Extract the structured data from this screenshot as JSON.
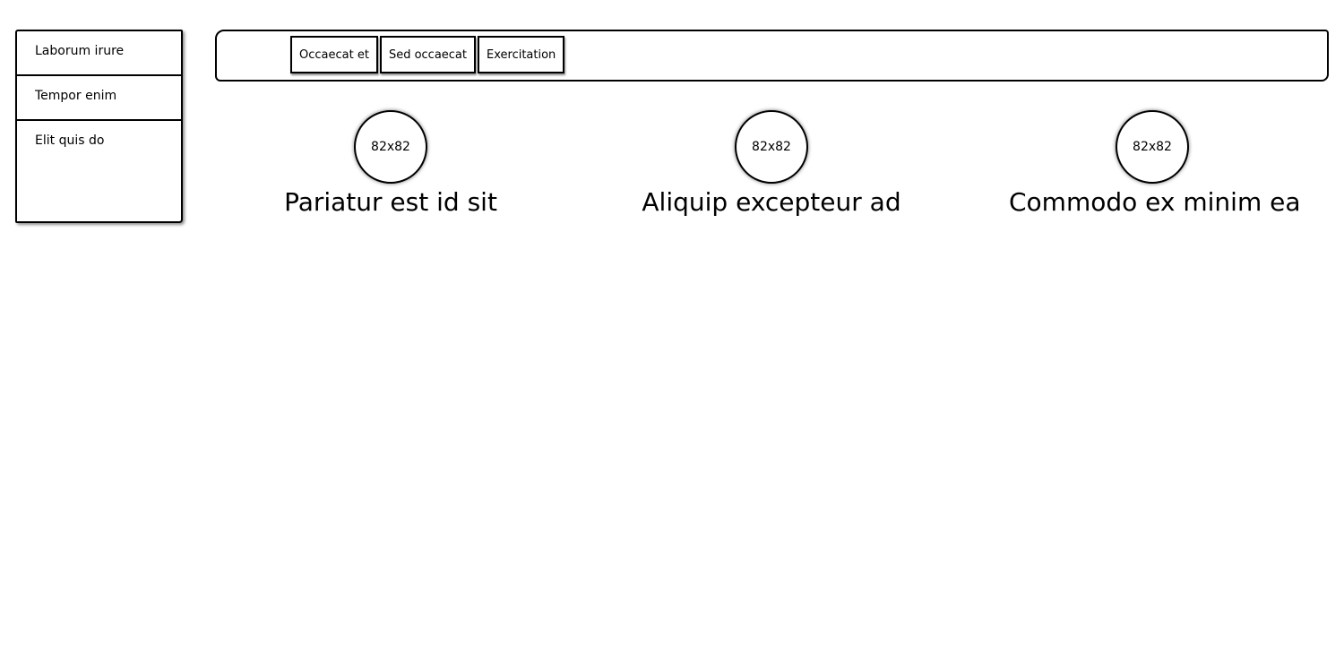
{
  "sidebar": {
    "items": [
      {
        "label": "Laborum irure"
      },
      {
        "label": "Tempor enim"
      },
      {
        "label": "Elit quis do"
      }
    ]
  },
  "topbar": {
    "tabs": [
      {
        "label": "Occaecat et"
      },
      {
        "label": "Sed occaecat"
      },
      {
        "label": "Exercitation"
      }
    ]
  },
  "cards": [
    {
      "image_label": "82x82",
      "title": "Pariatur est id sit"
    },
    {
      "image_label": "82x82",
      "title": "Aliquip excepteur ad"
    },
    {
      "image_label": "82x82",
      "title": "Commodo ex minim ea"
    }
  ]
}
